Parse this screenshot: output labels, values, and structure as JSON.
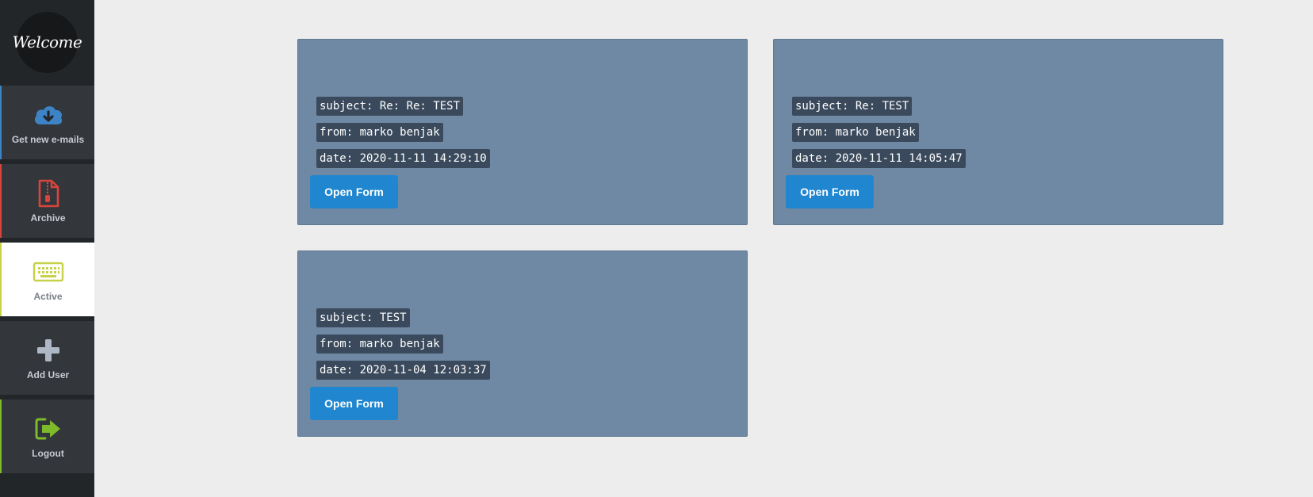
{
  "logo_text": "Welcome",
  "sidebar": {
    "items": [
      {
        "label": "Get new e-mails",
        "icon": "cloud-download-icon",
        "accent": "#3d84c6"
      },
      {
        "label": "Archive",
        "icon": "file-zipper-icon",
        "accent": "#d9443d"
      },
      {
        "label": "Active",
        "icon": "keyboard-icon",
        "accent": "#c7d14a"
      },
      {
        "label": "Add User",
        "icon": "plus-icon",
        "accent": "#aeb8c4"
      },
      {
        "label": "Logout",
        "icon": "sign-out-icon",
        "accent": "#7dbb2a"
      }
    ],
    "active_index": 2
  },
  "emails": [
    {
      "subject": "subject: Re: Re: TEST",
      "from": "from: marko benjak",
      "date": "date: 2020-11-11 14:29:10",
      "button": "Open Form"
    },
    {
      "subject": "subject: Re: TEST",
      "from": "from: marko benjak",
      "date": "date: 2020-11-11 14:05:47",
      "button": "Open Form"
    },
    {
      "subject": "subject: TEST",
      "from": "from: marko benjak",
      "date": "date: 2020-11-04 12:03:37",
      "button": "Open Form"
    }
  ],
  "colors": {
    "card_bg": "#6f89a4",
    "tag_bg": "#3a4a5c",
    "button_bg": "#1f86cf",
    "sidebar_bg": "#232629"
  }
}
